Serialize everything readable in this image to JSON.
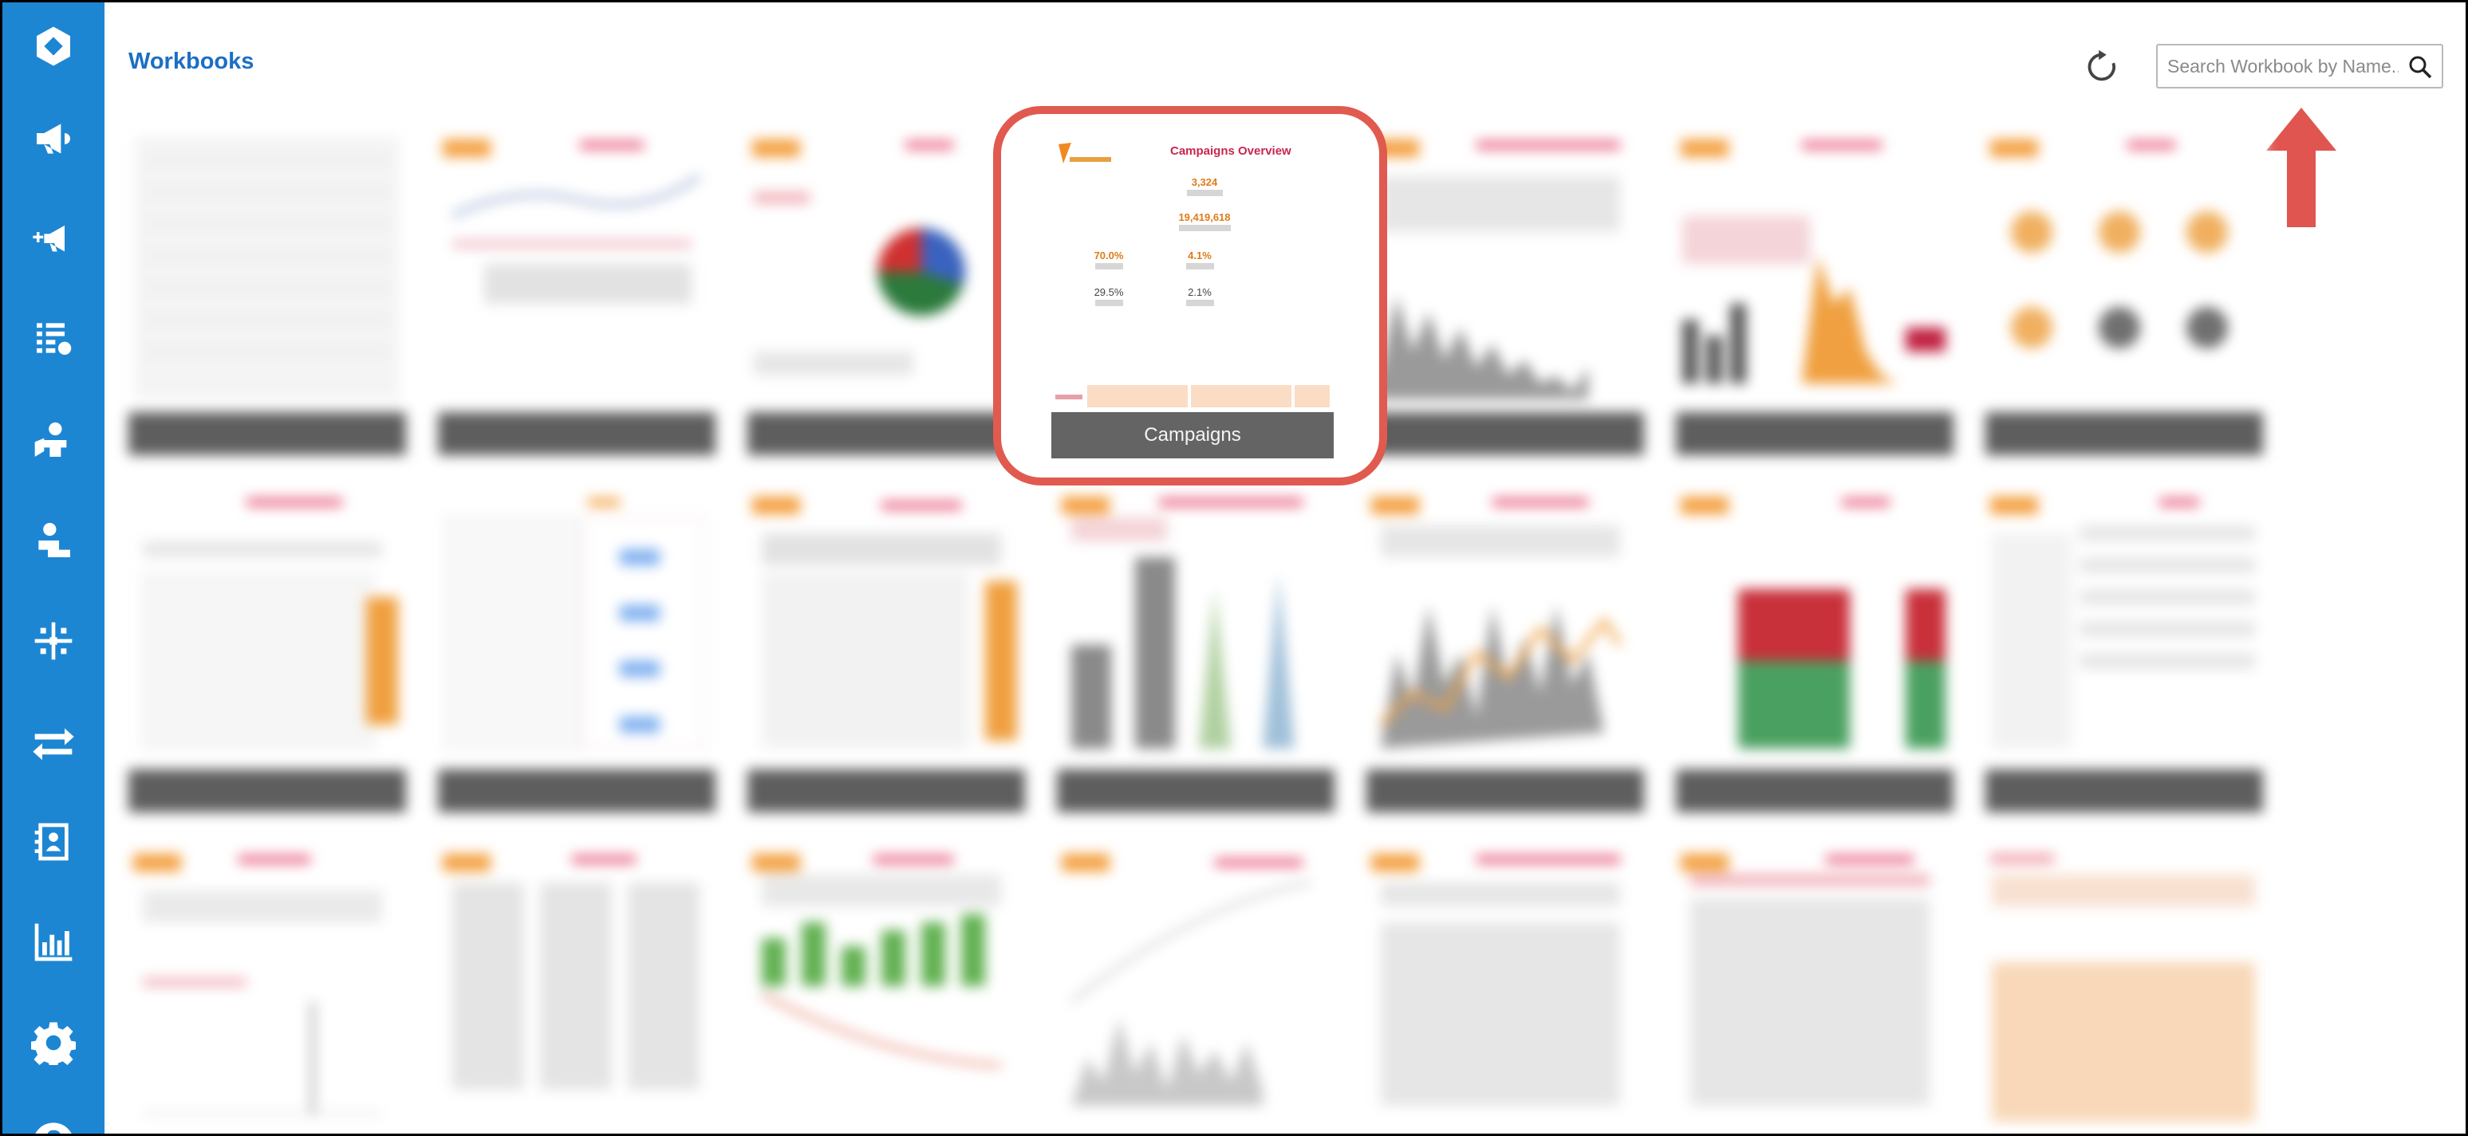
{
  "header": {
    "title": "Workbooks",
    "search_placeholder": "Search Workbook by Name..."
  },
  "sidebar": {
    "items": [
      {
        "icon": "cube-logo-icon"
      },
      {
        "icon": "megaphone-icon"
      },
      {
        "icon": "megaphone-add-icon"
      },
      {
        "icon": "list-settings-icon"
      },
      {
        "icon": "person-hand-icon"
      },
      {
        "icon": "person-desk-icon"
      },
      {
        "icon": "network-icon"
      },
      {
        "icon": "transfer-arrows-icon"
      },
      {
        "icon": "contact-card-icon"
      },
      {
        "icon": "bar-chart-icon"
      },
      {
        "icon": "gear-icon"
      },
      {
        "icon": "help-icon"
      }
    ]
  },
  "featured_card": {
    "label": "Campaigns",
    "thumb_title": "Campaigns Overview",
    "kpis": [
      {
        "value": "3,324"
      },
      {
        "value": "19,419,618"
      },
      {
        "value": "70.0%"
      },
      {
        "value": "4.1%"
      },
      {
        "value": "29.5%"
      },
      {
        "value": "2.1%"
      }
    ]
  },
  "colors": {
    "sidebar": "#1d86d3",
    "title": "#1b6fc4",
    "highlight": "#e05a50",
    "card_label_bg": "#5e5e5e",
    "accent_orange": "#f0a040",
    "accent_pink": "#e0406a"
  }
}
